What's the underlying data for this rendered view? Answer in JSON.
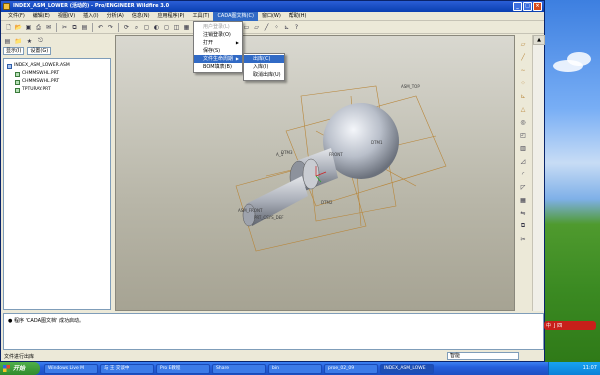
{
  "window": {
    "title": "INDEX_ASM_LOWER (活动的) - Pro/ENGINEER Wildfire 3.0"
  },
  "menubar": [
    "文件(F)",
    "编辑(E)",
    "视图(V)",
    "插入(I)",
    "分析(A)",
    "信息(N)",
    "应用程序(P)",
    "工具(T)",
    "CADA图文档(C)",
    "窗口(W)",
    "帮助(H)"
  ],
  "cada_menu": {
    "items": [
      "用户登录(L)",
      "注销登录(O)",
      "打开",
      "保存(S)",
      "文件生命周期",
      "BOM填表(B)"
    ],
    "highlighted": "文件生命周期"
  },
  "lifecycle_submenu": {
    "items": [
      "出库(C)",
      "入库(I)",
      "取消出库(U)"
    ],
    "highlighted": "出库(C)"
  },
  "left_panel": {
    "display_label": "显示(I)",
    "settings_label": "设置(G)",
    "tree": {
      "root": "INDEX_ASM_LOWER.ASM",
      "children": [
        "CHMMSWHL.PRT",
        "CHMMSWHL.PRT",
        "TPTURAY.PRT"
      ]
    }
  },
  "model_labels": {
    "d1": "ASM_TOP",
    "d2": "DTM1",
    "d3": "DTM2",
    "d4": "DTM3",
    "d5": "A_1",
    "d6": "ASM_FRONT",
    "d7": "PRT_CSYS_DEF",
    "d8": "FRONT"
  },
  "message": "● 程序 'CADA图文档' 成功启动。",
  "status": {
    "left": "文件进行出库",
    "filter": "智能"
  },
  "taskbar": {
    "start": "开始",
    "tasks": [
      "Windows Live M",
      "与 王 交谈中",
      "Pro E教程",
      "Share",
      "bin",
      "proe_02_09",
      "INDEX_ASM_LOWE"
    ],
    "clock": "11:07"
  },
  "ime": {
    "label": "中",
    "extra": "J 四"
  },
  "colors": {
    "titlebar": "#0a3fb0",
    "menu_highlight": "#316ac5",
    "datum": "#b8863a"
  }
}
